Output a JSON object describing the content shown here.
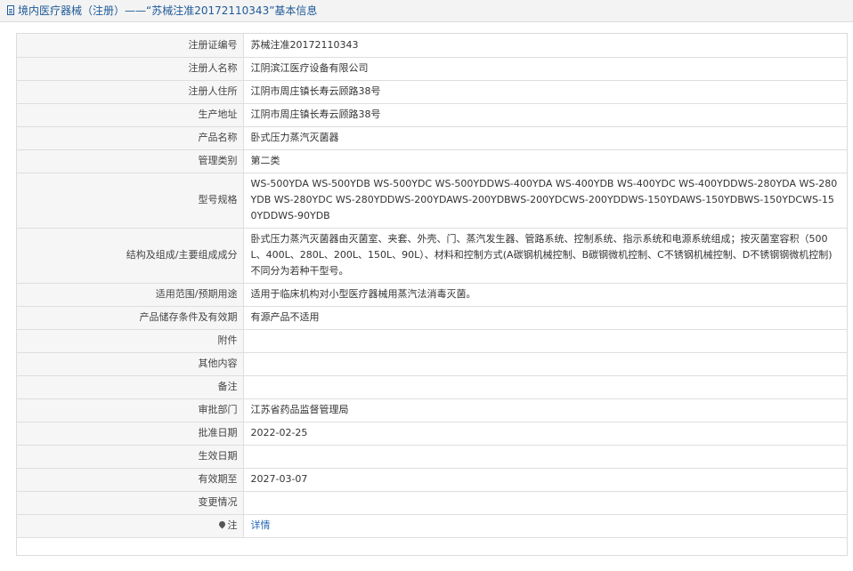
{
  "header": {
    "title": "境内医疗器械（注册）——“苏械注准20172110343”基本信息"
  },
  "rows": [
    {
      "label": "注册证编号",
      "value": "苏械注准20172110343"
    },
    {
      "label": "注册人名称",
      "value": "江阴滨江医疗设备有限公司"
    },
    {
      "label": "注册人住所",
      "value": "江阴市周庄镇长寿云顾路38号"
    },
    {
      "label": "生产地址",
      "value": "江阴市周庄镇长寿云顾路38号"
    },
    {
      "label": "产品名称",
      "value": "卧式压力蒸汽灭菌器"
    },
    {
      "label": "管理类别",
      "value": "第二类"
    },
    {
      "label": "型号规格",
      "value": "WS-500YDA WS-500YDB WS-500YDC WS-500YDDWS-400YDA WS-400YDB WS-400YDC WS-400YDDWS-280YDA WS-280YDB WS-280YDC WS-280YDDWS-200YDAWS-200YDBWS-200YDCWS-200YDDWS-150YDAWS-150YDBWS-150YDCWS-150YDDWS-90YDB"
    },
    {
      "label": "结构及组成/主要组成成分",
      "value": "卧式压力蒸汽灭菌器由灭菌室、夹套、外壳、门、蒸汽发生器、管路系统、控制系统、指示系统和电源系统组成；按灭菌室容积（500L、400L、280L、200L、150L、90L）、材料和控制方式(A碳钢机械控制、B碳钢微机控制、C不锈钢机械控制、D不锈钢钢微机控制)不同分为若种干型号。"
    },
    {
      "label": "适用范围/预期用途",
      "value": "适用于临床机构对小型医疗器械用蒸汽法消毒灭菌。"
    },
    {
      "label": "产品储存条件及有效期",
      "value": "有源产品不适用"
    },
    {
      "label": "附件",
      "value": ""
    },
    {
      "label": "其他内容",
      "value": ""
    },
    {
      "label": "备注",
      "value": ""
    },
    {
      "label": "审批部门",
      "value": "江苏省药品监督管理局"
    },
    {
      "label": "批准日期",
      "value": "2022-02-25"
    },
    {
      "label": "生效日期",
      "value": ""
    },
    {
      "label": "有效期至",
      "value": "2027-03-07"
    },
    {
      "label": "变更情况",
      "value": ""
    },
    {
      "label": "注",
      "value": "详情",
      "icon": "location-pin-icon",
      "link_color": "#2566b4"
    }
  ],
  "colors": {
    "title": "#1f5a98",
    "label_bg": "#f6f6f6",
    "border": "#dedede",
    "link": "#2566b4"
  }
}
